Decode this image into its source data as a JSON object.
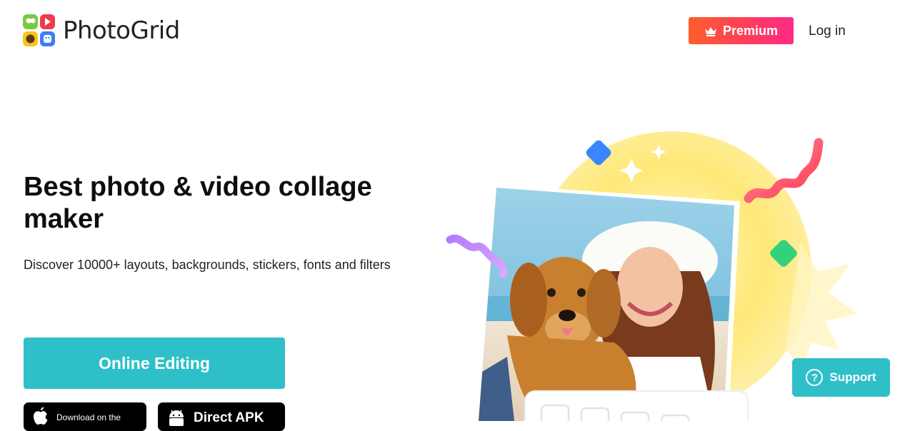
{
  "header": {
    "logo_text": "PhotoGrid",
    "premium_label": "Premium",
    "login_label": "Log in"
  },
  "hero": {
    "title": "Best photo & video collage maker",
    "description": "Discover 10000+ layouts, backgrounds, stickers, fonts and filters",
    "online_editing_label": "Online Editing"
  },
  "downloads": {
    "apple_small": "Download on the",
    "apk_label": "Direct APK"
  },
  "support": {
    "label": "Support",
    "help_glyph": "?"
  },
  "icons": {
    "logo": "photogrid-logo-icon",
    "crown": "crown-icon",
    "apple": "apple-icon",
    "android": "android-icon",
    "help": "help-circle-icon"
  },
  "colors": {
    "accent_teal": "#2fbfc8",
    "premium_start": "#ff5e2b",
    "premium_end": "#ff2a86",
    "sun_yellow": "#ffe15a"
  }
}
